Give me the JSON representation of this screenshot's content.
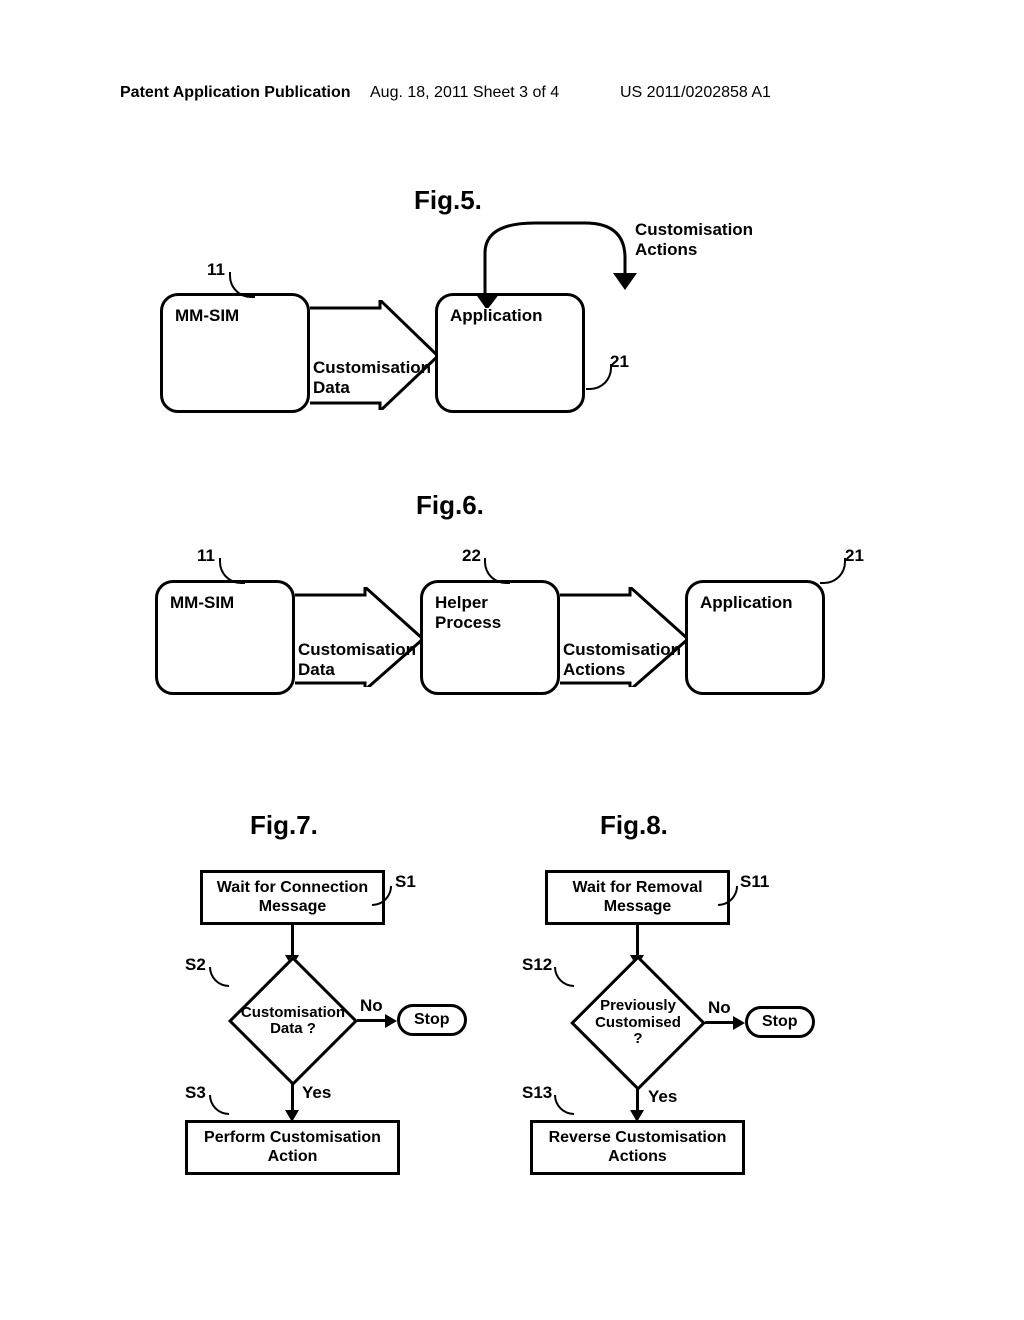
{
  "header": {
    "left": "Patent Application Publication",
    "mid": "Aug. 18, 2011  Sheet 3 of 4",
    "right": "US 2011/0202858 A1"
  },
  "fig5": {
    "title": "Fig.5.",
    "mmsim": "MM-SIM",
    "refL": "11",
    "arrowLabel": "Customisation Data",
    "app": "Application",
    "refR": "21",
    "selfArrow": "Customisation Actions"
  },
  "fig6": {
    "title": "Fig.6.",
    "mmsim": "MM-SIM",
    "refL": "11",
    "arrow1": "Customisation Data",
    "helper": "Helper Process",
    "refM": "22",
    "arrow2": "Customisation Actions",
    "app": "Application",
    "refR": "21"
  },
  "fig7": {
    "title": "Fig.7.",
    "s1": {
      "ref": "S1",
      "text": "Wait for Connection Message"
    },
    "s2": {
      "ref": "S2",
      "text": "Customisation Data ?"
    },
    "s3": {
      "ref": "S3",
      "text": "Perform Customisation Action"
    },
    "yes": "Yes",
    "no": "No",
    "stop": "Stop"
  },
  "fig8": {
    "title": "Fig.8.",
    "s11": {
      "ref": "S11",
      "text": "Wait for Removal Message"
    },
    "s12": {
      "ref": "S12",
      "text": "Previously Customised ?"
    },
    "s13": {
      "ref": "S13",
      "text": "Reverse Customisation Actions"
    },
    "yes": "Yes",
    "no": "No",
    "stop": "Stop"
  }
}
